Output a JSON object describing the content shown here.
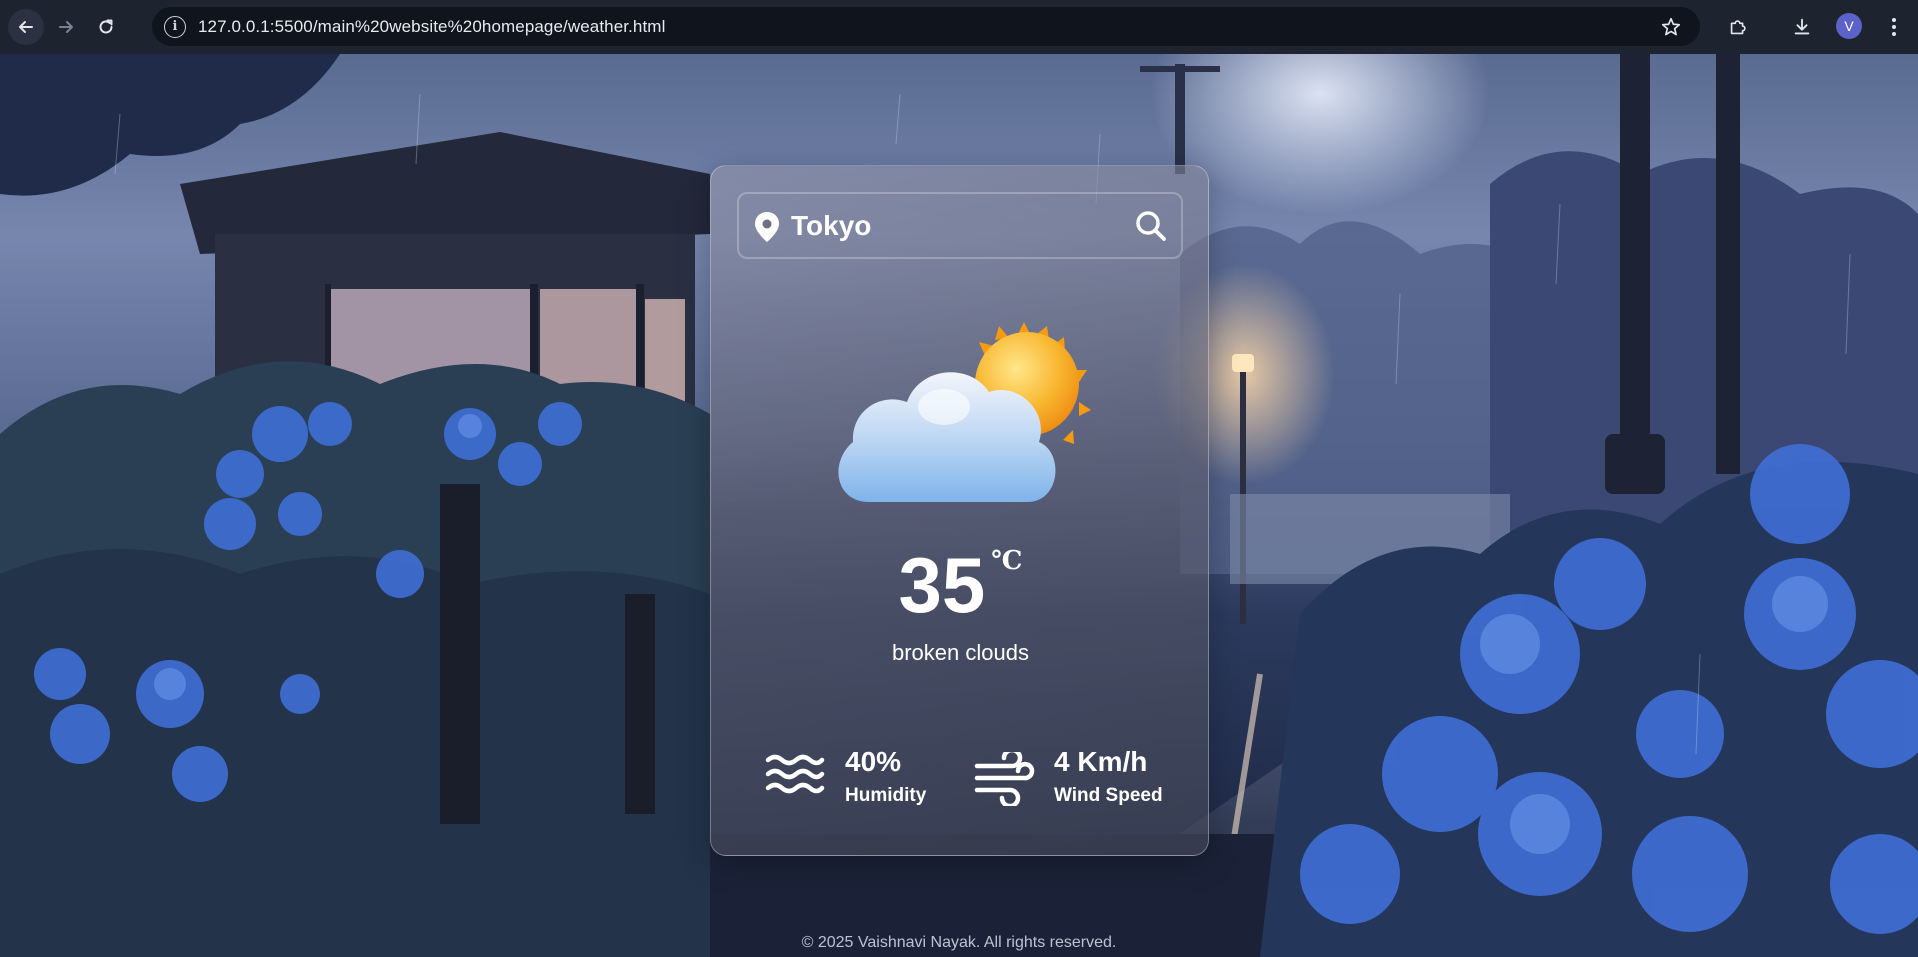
{
  "browser": {
    "url": "127.0.0.1:5500/main%20website%20homepage/weather.html",
    "profile_initial": "V",
    "icons": [
      "back-arrow-icon",
      "forward-arrow-icon",
      "reload-icon",
      "site-info-icon",
      "bookmark-star-icon",
      "extensions-icon",
      "download-icon",
      "more-menu-icon"
    ]
  },
  "weather": {
    "city": "Tokyo",
    "icon": "partly-cloudy-sun-icon",
    "temperature": "35",
    "unit": "℃",
    "description": "broken clouds",
    "humidity": {
      "value": "40%",
      "label": "Humidity",
      "icon": "humidity-waves-icon"
    },
    "wind": {
      "value": "4 Km/h",
      "label": "Wind Speed",
      "icon": "wind-icon"
    }
  },
  "footer": {
    "text": "© 2025 Vaishnavi Nayak. All rights reserved."
  },
  "colors": {
    "chrome_bg": "#1e2330",
    "omnibox_bg": "#10141d",
    "avatar_bg": "#5b63c9",
    "hydrangea": "#3f6fd6",
    "sun": "#f6a623"
  }
}
